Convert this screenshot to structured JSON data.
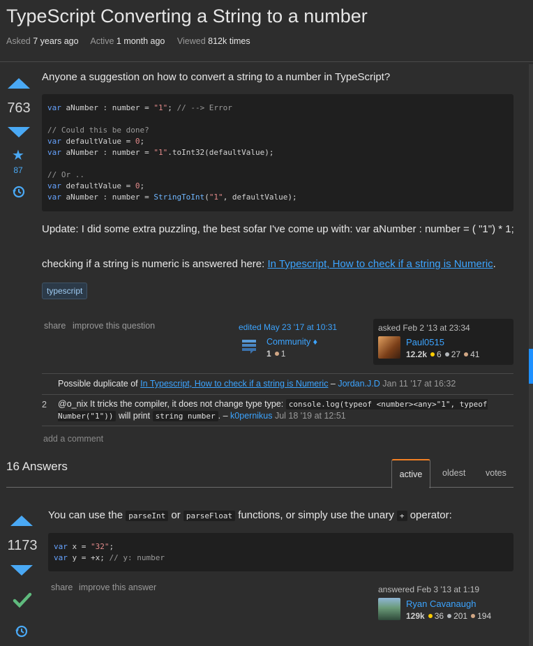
{
  "question": {
    "title": "TypeScript Converting a String to a number",
    "meta": {
      "asked_label": "Asked",
      "asked_value": "7 years ago",
      "active_label": "Active",
      "active_value": "1 month ago",
      "viewed_label": "Viewed",
      "viewed_value": "812k times"
    },
    "score": "763",
    "favorites": "87",
    "intro": "Anyone a suggestion on how to convert a string to a number in TypeScript?",
    "code_lines": [
      "var aNumber : number = \"1\"; // --> Error",
      "",
      "// Could this be done?",
      "var defaultValue = 0;",
      "var aNumber : number = \"1\".toInt32(defaultValue);",
      "",
      "// Or ..",
      "var defaultValue = 0;",
      "var aNumber : number = StringToInt(\"1\", defaultValue);"
    ],
    "update_text": "Update: I did some extra puzzling, the best sofar I've come up with: var aNumber : number = ( \"1\") * 1;",
    "numeric_prefix": "checking if a string is numeric is answered here: ",
    "numeric_link": "In Typescript, How to check if a string is Numeric",
    "numeric_suffix": ".",
    "tag": "typescript",
    "share": "share",
    "improve": "improve this question",
    "edited": {
      "label": "edited May 23 '17 at 10:31",
      "user": "Community ♦",
      "rep": "1",
      "bronze": "1"
    },
    "asked": {
      "label": "asked Feb 2 '13 at 23:34",
      "user": "Paul0515",
      "rep": "12.2k",
      "gold": "6",
      "silver": "27",
      "bronze": "41"
    }
  },
  "comments": [
    {
      "score": "",
      "text_prefix": "Possible duplicate of ",
      "link": "In Typescript, How to check if a string is Numeric",
      "dash": " – ",
      "author": "Jordan.J.D",
      "date": " Jan 11 '17 at 16:32"
    },
    {
      "score": "2",
      "part1": "@o_nix It tricks the compiler, it does not change type type: ",
      "code1": "console.log(typeof <number><any>\"1\", typeof Number(\"1\"))",
      "part2": " will print ",
      "code2": "string number",
      "part3": ". – ",
      "author": "k0pernikus",
      "date": " Jul 18 '19 at 12:51"
    }
  ],
  "add_comment": "add a comment",
  "answers_header": {
    "count": "16 Answers",
    "tabs": [
      "active",
      "oldest",
      "votes"
    ]
  },
  "answer": {
    "score": "1173",
    "t1": "You can use the ",
    "c1": "parseInt",
    "t2": " or ",
    "c2": "parseFloat",
    "t3": " functions, or simply use the unary ",
    "c3": "+",
    "t4": " operator:",
    "code_lines": [
      "var x = \"32\";",
      "var y = +x; // y: number"
    ],
    "share": "share",
    "improve": "improve this answer",
    "answered": {
      "label": "answered Feb 3 '13 at 1:19",
      "user": "Ryan Cavanaugh",
      "rep": "129k",
      "gold": "36",
      "silver": "201",
      "bronze": "194"
    }
  },
  "icons": {
    "upvote": "triangle-up",
    "downvote": "triangle-down",
    "favorite": "star",
    "history": "clock-history",
    "accepted": "checkmark"
  },
  "colors": {
    "accent": "#4aa9f5",
    "link": "#3ca4ff",
    "background": "#2d2d2d",
    "accepted": "#5fba7d",
    "tab_active": "#f48024"
  }
}
